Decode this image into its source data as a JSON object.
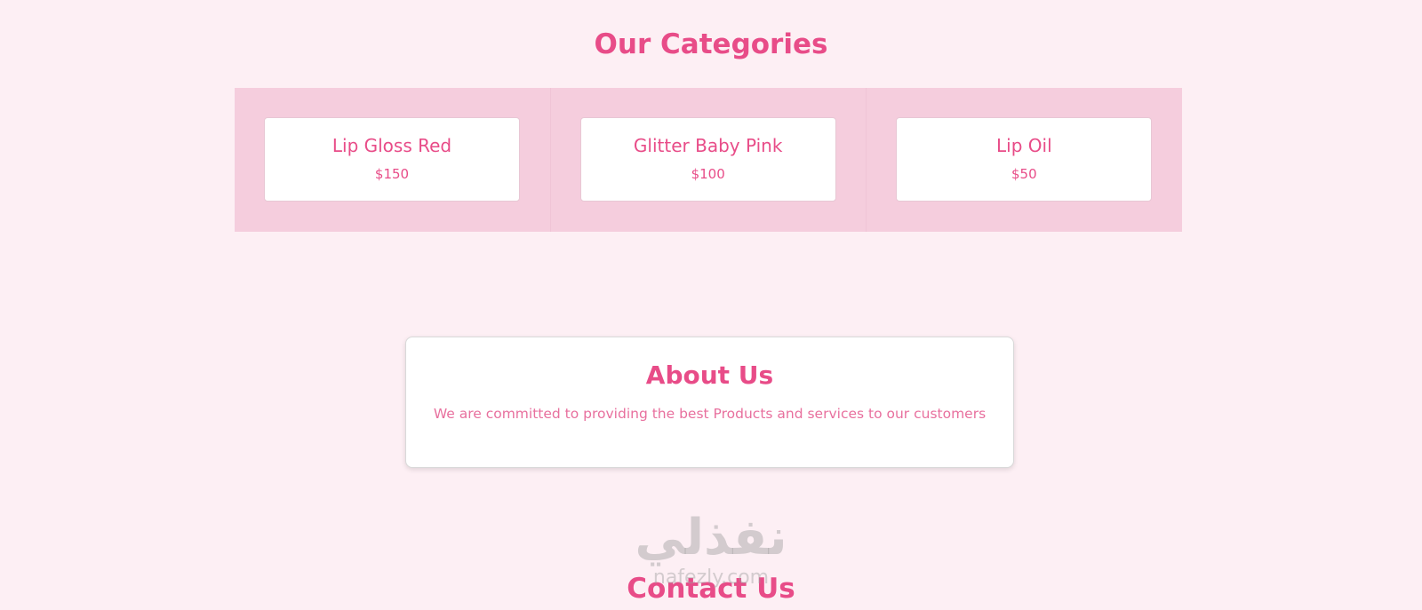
{
  "categories": {
    "title": "Our Categories",
    "items": [
      {
        "name": "Lip Gloss Red",
        "price": "$150"
      },
      {
        "name": "Glitter Baby Pink",
        "price": "$100"
      },
      {
        "name": "Lip Oil",
        "price": "$50"
      }
    ]
  },
  "about": {
    "title": "About Us",
    "text": "We are committed to providing the best Products and services to our customers"
  },
  "contact": {
    "title": "Contact Us"
  },
  "watermark": {
    "arabic": "نفذلي",
    "latin": "nafezly.com"
  },
  "colors": {
    "accent": "#e84c88",
    "page_background": "#fdeff4",
    "band_background": "#f5cddd",
    "card_background": "#ffffff"
  }
}
